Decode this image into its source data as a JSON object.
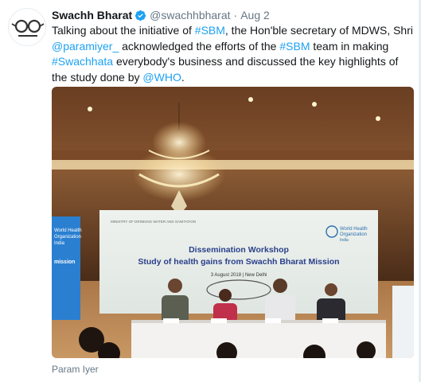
{
  "tweet": {
    "author_name": "Swachh Bharat",
    "handle": "@swachhbharat",
    "separator": "·",
    "date": "Aug 2",
    "body": [
      {
        "t": "Talking about the initiative of "
      },
      {
        "t": "#SBM",
        "link": true
      },
      {
        "t": ", the Hon'ble secretary of MDWS, Shri "
      },
      {
        "t": "@paramiyer_",
        "link": true
      },
      {
        "t": " acknowledged the efforts of the "
      },
      {
        "t": "#SBM",
        "link": true
      },
      {
        "t": " team in making "
      },
      {
        "t": "#Swachhata",
        "link": true
      },
      {
        "t": " everybody's business and discussed the key highlights of the study done by "
      },
      {
        "t": "@WHO",
        "link": true
      },
      {
        "t": "."
      }
    ],
    "photo_caption": "Param Iyer"
  },
  "photo": {
    "banner_title": "Dissemination Workshop",
    "banner_subtitle": "Study of health gains from Swachh Bharat Mission",
    "banner_date": "3 August 2018 | New Delhi",
    "who_label_1": "World Health",
    "who_label_2": "Organization",
    "who_label_3": "India",
    "ministry_label": "MINISTRY OF DRINKING WATER AND SANITATION",
    "side_screen_1": "World Health",
    "side_screen_2": "Organization",
    "side_screen_3": "India",
    "side_screen_4": "mission"
  },
  "colors": {
    "link": "#1da1f2",
    "verified": "#1da1f2",
    "muted": "#657786",
    "text": "#14171a"
  },
  "icons": {
    "verified": "verified-badge-icon",
    "avatar": "swachh-bharat-spectacles-logo"
  }
}
